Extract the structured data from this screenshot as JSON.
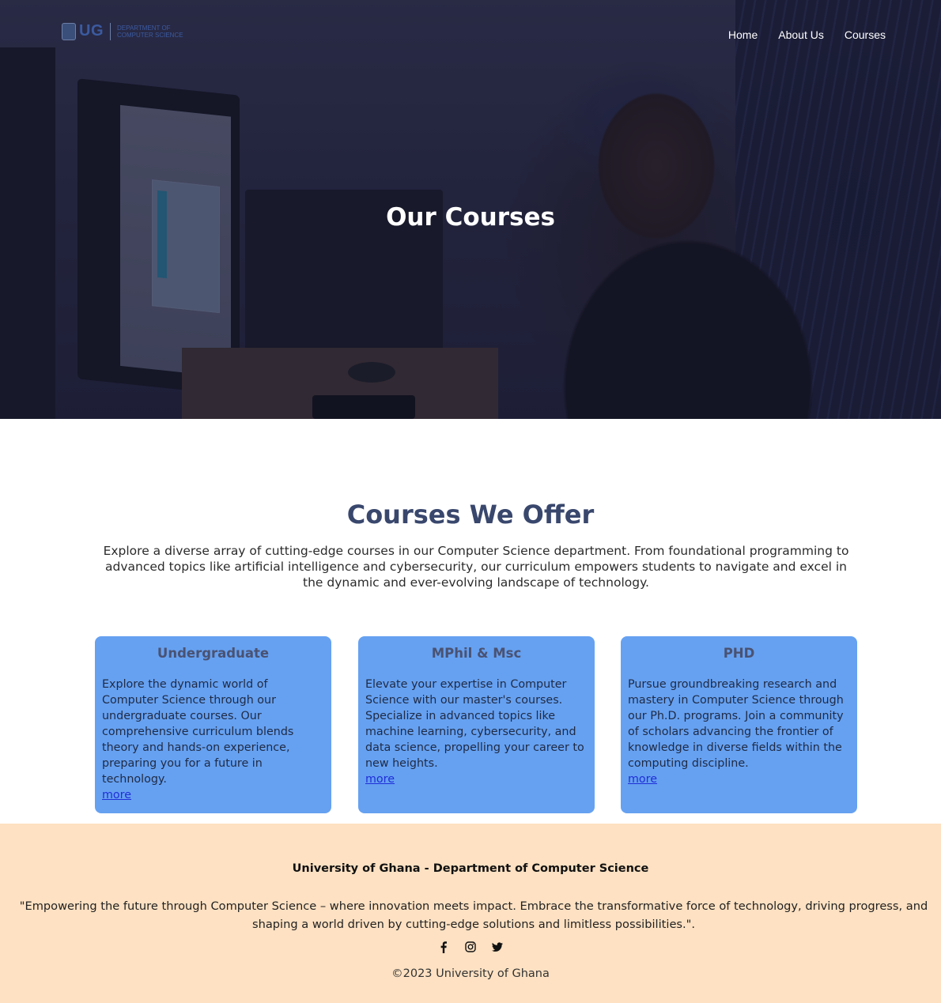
{
  "brand": {
    "logo_text": "UG",
    "dept_text": "Department of Computer Science"
  },
  "nav": {
    "items": [
      "Home",
      "About Us",
      "Courses"
    ]
  },
  "hero": {
    "title": "Our Courses"
  },
  "courses": {
    "heading": "Courses We Offer",
    "intro": "Explore a diverse array of cutting-edge courses in our Computer Science department. From foundational programming to advanced topics like artificial intelligence and cybersecurity, our curriculum empowers students to navigate and excel in the dynamic and ever-evolving landscape of technology.",
    "cards": [
      {
        "title": "Undergraduate",
        "text": "Explore the dynamic world of Computer Science through our undergraduate courses. Our comprehensive curriculum blends theory and hands-on experience, preparing you for a future in technology.",
        "link": "more"
      },
      {
        "title": "MPhil & Msc",
        "text": "Elevate your expertise in Computer Science with our master's courses. Specialize in advanced topics like machine learning, cybersecurity, and data science, propelling your career to new heights.",
        "link": "more"
      },
      {
        "title": "PHD",
        "text": "Pursue groundbreaking research and mastery in Computer Science through our Ph.D. programs. Join a community of scholars advancing the frontier of knowledge in diverse fields within the computing discipline.",
        "link": "more"
      }
    ]
  },
  "footer": {
    "org": "University of Ghana - Department of Computer Science",
    "quote": "\"Empowering the future through Computer Science – where innovation meets impact. Embrace the transformative force of technology, driving progress, and shaping a world driven by cutting-edge solutions and limitless possibilities.\".",
    "social_icons": [
      "facebook-icon",
      "instagram-icon",
      "twitter-icon"
    ],
    "copyright": "©2023 University of Ghana"
  },
  "colors": {
    "card": "#66a1f1",
    "heading": "#39476d",
    "footer_bg": "#fde1c2",
    "link": "#1f2fd8"
  }
}
